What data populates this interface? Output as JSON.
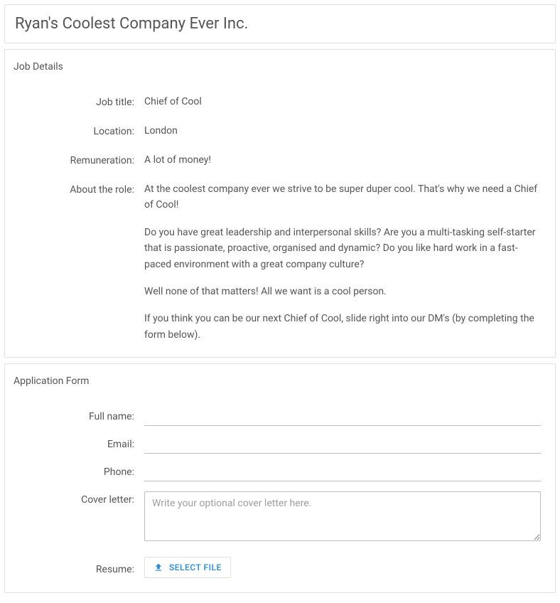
{
  "header": {
    "company_name": "Ryan's Coolest Company Ever Inc."
  },
  "job_details": {
    "section_title": "Job Details",
    "title_label": "Job title:",
    "title_value": "Chief of Cool",
    "location_label": "Location:",
    "location_value": "London",
    "remuneration_label": "Remuneration:",
    "remuneration_value": "A lot of money!",
    "about_label": "About the role:",
    "about_p1": "At the coolest company ever we strive to be super duper cool. That's why we need a Chief of Cool!",
    "about_p2": "Do you have great leadership and interpersonal skills? Are you a multi-tasking self-starter that is passionate, proactive, organised and dynamic? Do you like hard work in a fast-paced environment with a great company culture?",
    "about_p3": "Well none of that matters! All we want is a cool person.",
    "about_p4": "If you think you can be our next Chief of Cool, slide right into our DM's (by completing the form below)."
  },
  "application_form": {
    "section_title": "Application Form",
    "full_name_label": "Full name:",
    "email_label": "Email:",
    "phone_label": "Phone:",
    "cover_letter_label": "Cover letter:",
    "cover_letter_placeholder": "Write your optional cover letter here.",
    "resume_label": "Resume:",
    "select_file_label": "Select File"
  }
}
